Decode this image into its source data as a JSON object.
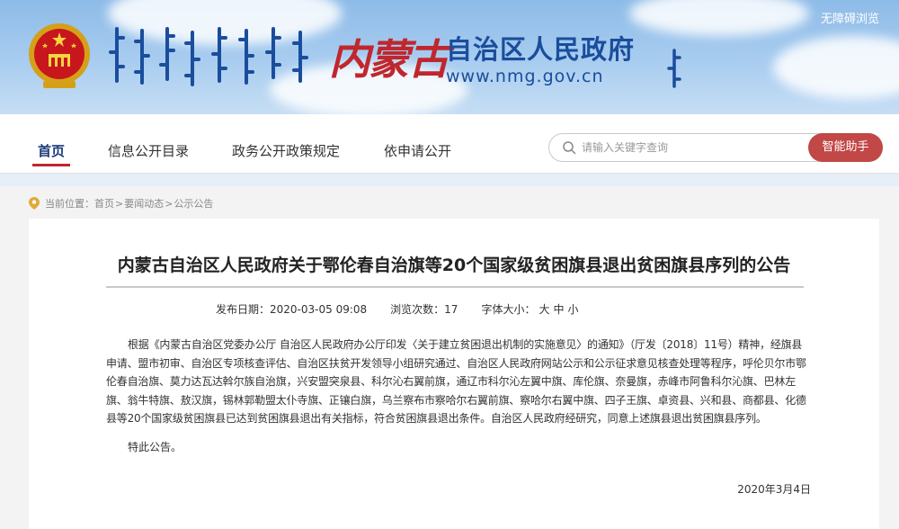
{
  "header": {
    "brand_calligraphy": "内蒙古",
    "brand_title": "自治区人民政府",
    "brand_url": "www.nmg.gov.cn",
    "accessibility_link": "无障碍浏览",
    "banner_color": "#a9cdf0",
    "brand_color": "#1a4d9c",
    "accent_color": "#c0272d"
  },
  "nav": {
    "items": [
      {
        "label": "首页",
        "active": true
      },
      {
        "label": "信息公开目录",
        "active": false
      },
      {
        "label": "政务公开政策规定",
        "active": false
      },
      {
        "label": "依申请公开",
        "active": false
      }
    ]
  },
  "search": {
    "placeholder": "请输入关键字查询",
    "icon": "search-icon",
    "assistant_label": "智能助手",
    "assistant_color": "#c24747"
  },
  "breadcrumb": {
    "prefix": "当前位置：",
    "items": [
      "首页",
      "要闻动态",
      "公示公告"
    ],
    "separator": ">",
    "icon": "location-pin-icon"
  },
  "article": {
    "title": "内蒙古自治区人民政府关于鄂伦春自治旗等20个国家级贫困旗县退出贫困旗县序列的公告",
    "publish_label": "发布日期：",
    "publish_date": "2020-03-05 09:08",
    "views_label": "浏览次数：",
    "views": "17",
    "font_size_label": "字体大小：",
    "font_size_options": [
      "大",
      "中",
      "小"
    ],
    "body": "根据《内蒙古自治区党委办公厅 自治区人民政府办公厅印发〈关于建立贫困退出机制的实施意见〉的通知》（厅发〔2018〕11号）精神，经旗县申请、盟市初审、自治区专项核查评估、自治区扶贫开发领导小组研究通过、自治区人民政府网站公示和公示征求意见核查处理等程序，呼伦贝尔市鄂伦春自治旗、莫力达瓦达斡尔族自治旗，兴安盟突泉县、科尔沁右翼前旗，通辽市科尔沁左翼中旗、库伦旗、奈曼旗，赤峰市阿鲁科尔沁旗、巴林左旗、翁牛特旗、敖汉旗，锡林郭勒盟太仆寺旗、正镶白旗，乌兰察布市察哈尔右翼前旗、察哈尔右翼中旗、四子王旗、卓资县、兴和县、商都县、化德县等20个国家级贫困旗县已达到贫困旗县退出有关指标，符合贫困旗县退出条件。自治区人民政府经研究，同意上述旗县退出贫困旗县序列。",
    "note": "特此公告。",
    "date": "2020年3月4日"
  }
}
